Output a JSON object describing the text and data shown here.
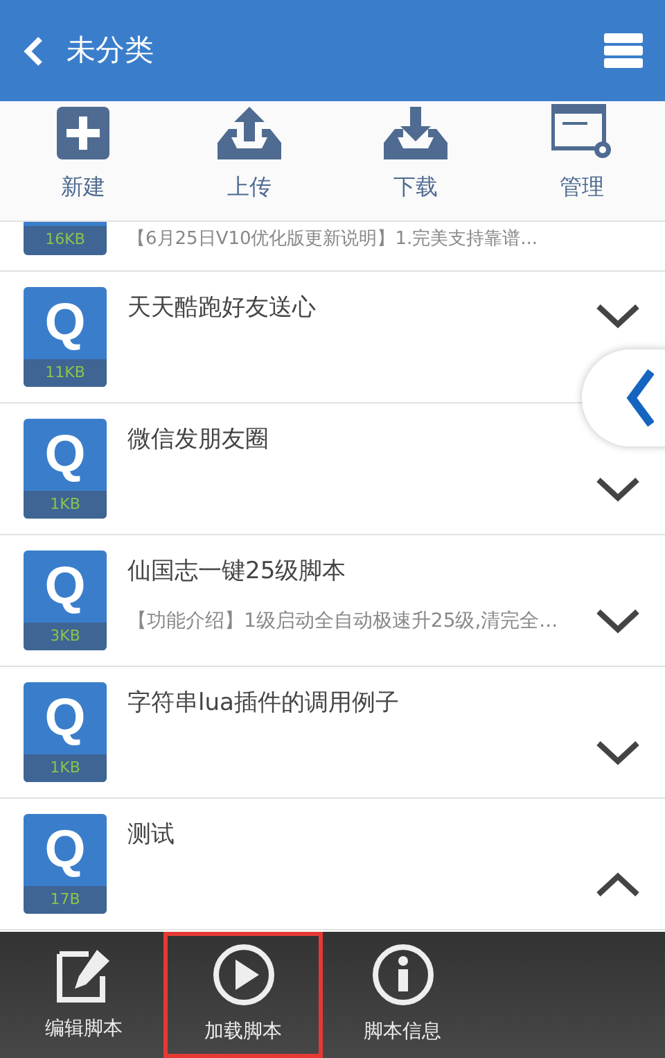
{
  "header": {
    "title": "未分类"
  },
  "toolbar": [
    {
      "kind": "new",
      "label": "新建"
    },
    {
      "kind": "upload",
      "label": "上传"
    },
    {
      "kind": "download",
      "label": "下载"
    },
    {
      "kind": "manage",
      "label": "管理"
    }
  ],
  "partial_row": {
    "size": "16KB",
    "description": "【6月25日V10优化版更新说明】1.完美支持靠谱..."
  },
  "scripts": [
    {
      "letter": "Q",
      "title": "天天酷跑好友送心",
      "size": "11KB",
      "expanded": false
    },
    {
      "letter": "Q",
      "title": "微信发朋友圈",
      "size": "1KB",
      "expanded": false
    },
    {
      "letter": "Q",
      "title": "仙国志一键25级脚本",
      "size": "3KB",
      "description": "【功能介绍】1级启动全自动极速升25级,清完全...",
      "expanded": false
    },
    {
      "letter": "Q",
      "title": "字符串lua插件的调用例子",
      "size": "1KB",
      "expanded": false
    },
    {
      "letter": "Q",
      "title": "测试",
      "size": "17B",
      "expanded": true
    }
  ],
  "bottom_bar": [
    {
      "kind": "edit",
      "label": "编辑脚本",
      "highlighted": false
    },
    {
      "kind": "play",
      "label": "加载脚本",
      "highlighted": true
    },
    {
      "kind": "info",
      "label": "脚本信息",
      "highlighted": false
    }
  ]
}
